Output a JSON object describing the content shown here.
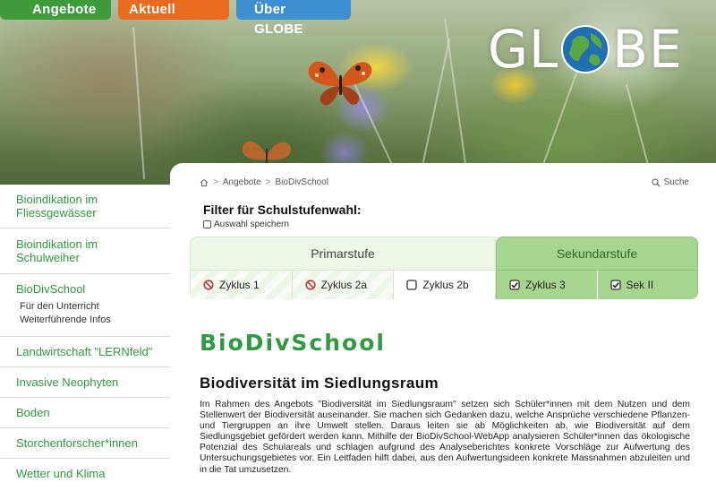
{
  "topnav": {
    "tabs": [
      {
        "label": "Angebote",
        "color": "#3f9a3c"
      },
      {
        "label": "Aktuell",
        "color": "#e96b1f"
      },
      {
        "label": "Über GLOBE",
        "color": "#3e8fd0"
      }
    ]
  },
  "logo": {
    "text_left": "GL",
    "text_right": "BE"
  },
  "sidebar": {
    "items": [
      {
        "label": "Bioindikation im Fliessgewässer"
      },
      {
        "label": "Bioindikation im Schulweiher"
      },
      {
        "label": "BioDivSchool",
        "subitems": [
          "Für den Unterricht",
          "Weiterführende Infos"
        ]
      },
      {
        "label": "Landwirtschaft \"LERNfeld\""
      },
      {
        "label": "Invasive Neophyten"
      },
      {
        "label": "Boden"
      },
      {
        "label": "Storchenforscher*innen"
      },
      {
        "label": "Wetter und Klima"
      }
    ]
  },
  "breadcrumb": {
    "sep": ">",
    "items": [
      "Angebote",
      "BioDivSchool"
    ]
  },
  "search": {
    "label": "Suche"
  },
  "filter": {
    "title": "Filter für Schulstufenwahl:",
    "save_label": "Auswahl speichern",
    "primar": {
      "label": "Primarstufe",
      "cycles": [
        {
          "label": "Zyklus 1",
          "state": "blocked"
        },
        {
          "label": "Zyklus 2a",
          "state": "blocked"
        },
        {
          "label": "Zyklus 2b",
          "state": "unchecked"
        }
      ]
    },
    "sekundar": {
      "label": "Sekundarstufe",
      "cycles": [
        {
          "label": "Zyklus 3",
          "state": "checked"
        },
        {
          "label": "Sek II",
          "state": "checked"
        }
      ]
    }
  },
  "content": {
    "page_title": "BioDivSchool",
    "section_title": "Biodiversität im Siedlungsraum",
    "body": "Im Rahmen des Angebots \"Biodiversität im Siedlungsraum\" setzen sich Schüler*innen mit dem Nutzen und dem Stellenwert der Biodiversität auseinander. Sie machen sich Gedanken dazu, welche Ansprüche verschiedene Pflanzen- und Tiergruppen an ihre Umwelt stellen. Daraus leiten sie ab Möglichkeiten ab, wie Biodiversität auf dem Siedlungsgebiet gefördert werden kann. Mithilfe der BioDivSchool-WebApp analysieren Schüler*innen das ökologische Potenzial des Schulareals und schlagen aufgrund des Analyseberichtes konkrete Vorschläge zur Aufwertung des Untersuchungsgebietes vor. Ein Leitfaden hilft dabei, aus den Aufwertungsideen konkrete Massnahmen abzuleiten und in die Tat umzusetzen."
  },
  "colors": {
    "accent_green": "#2f9a3f",
    "sekundar_bg": "#a7d48e",
    "primar_bg": "#edf5e8"
  }
}
